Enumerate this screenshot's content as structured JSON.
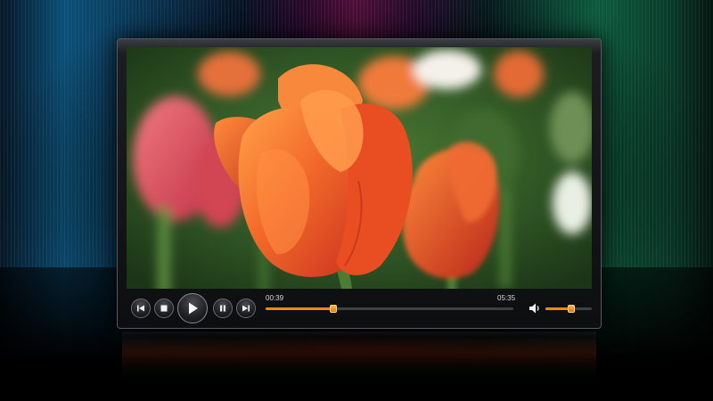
{
  "player": {
    "current_time": "00:39",
    "duration": "05:35",
    "progress_fraction": 0.273,
    "volume_fraction": 0.55,
    "state": "paused"
  },
  "icons": {
    "previous": "skip-previous-icon",
    "stop": "stop-icon",
    "play": "play-icon",
    "pause": "pause-icon",
    "next": "skip-next-icon",
    "volume": "speaker-volume-icon"
  },
  "colors": {
    "accent": "#f08a16",
    "controls_background": "#0d0e10",
    "control_icon": "#f2f2f2"
  }
}
